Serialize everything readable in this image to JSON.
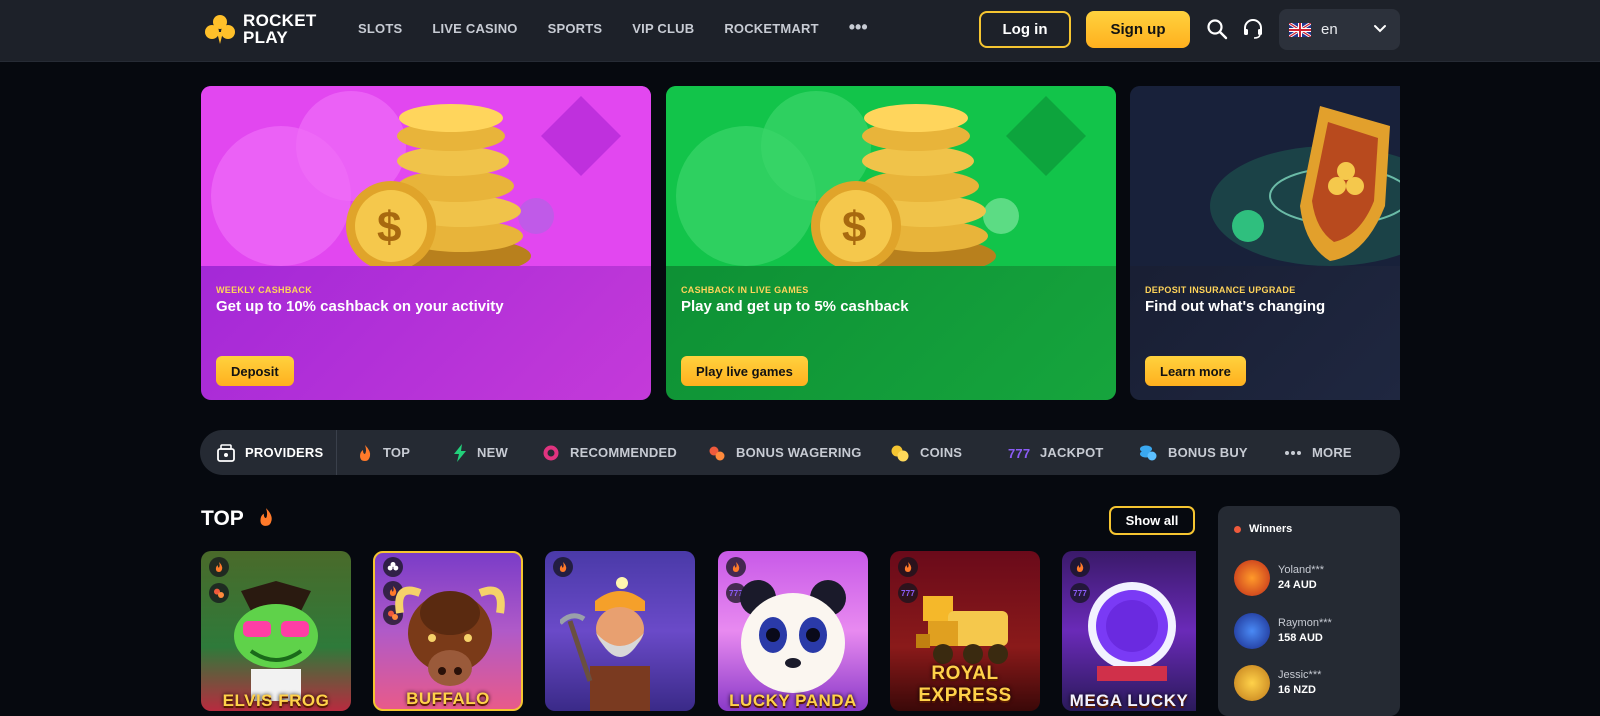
{
  "header": {
    "logo_line1": "ROCKET",
    "logo_line2": "PLAY",
    "nav": [
      "SLOTS",
      "LIVE CASINO",
      "SPORTS",
      "VIP CLUB",
      "ROCKETMART"
    ],
    "nav_more": "•••",
    "login_label": "Log in",
    "signup_label": "Sign up",
    "language": "en"
  },
  "promos": [
    {
      "tag": "WEEKLY CASHBACK",
      "title": "Get up to 10% cashback on your activity",
      "button": "Deposit"
    },
    {
      "tag": "CASHBACK IN LIVE GAMES",
      "title": "Play and get up to 5% cashback",
      "button": "Play live games"
    },
    {
      "tag": "DEPOSIT INSURANCE UPGRADE",
      "title": "Find out what's changing",
      "button": "Learn more"
    }
  ],
  "categories": [
    "PROVIDERS",
    "TOP",
    "NEW",
    "RECOMMENDED",
    "BONUS WAGERING",
    "COINS",
    "JACKPOT",
    "BONUS BUY",
    "MORE"
  ],
  "top": {
    "title": "TOP",
    "show_all": "Show all",
    "games": [
      "ELVIS FROG",
      "BUFFALO",
      "",
      "LUCKY PANDA",
      "ROYAL EXPRESS",
      "MEGA LUCKY"
    ]
  },
  "winners": {
    "title": "Winners",
    "items": [
      {
        "user": "Yoland***",
        "amount": "24 AUD"
      },
      {
        "user": "Raymon***",
        "amount": "158 AUD"
      },
      {
        "user": "Jessic***",
        "amount": "16 NZD"
      }
    ]
  },
  "colors": {
    "accent": "#ffc02a",
    "bg": "#06090f",
    "header": "#1d2129"
  }
}
